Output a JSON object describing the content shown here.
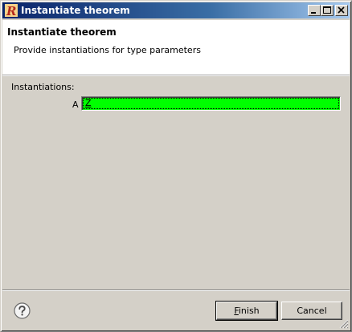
{
  "window": {
    "title": "Instantiate theorem",
    "icon": "r-app-icon",
    "controls": [
      "minimize",
      "maximize",
      "close"
    ]
  },
  "header": {
    "title": "Instantiate theorem",
    "description": "Provide instantiations for type parameters"
  },
  "form": {
    "section_label": "Instantiations:",
    "params": [
      {
        "name": "A",
        "value": "Z",
        "field_color": "#00ff00"
      }
    ]
  },
  "footer": {
    "help_icon": "question-mark-icon",
    "finish_prefix": "",
    "finish_mnemonic": "F",
    "finish_rest": "inish",
    "cancel_label": "Cancel"
  },
  "colors": {
    "titlebar_start": "#0a246a",
    "titlebar_end": "#a6caf0",
    "valid_field": "#00ff00",
    "dialog_bg": "#d4d0c8"
  }
}
